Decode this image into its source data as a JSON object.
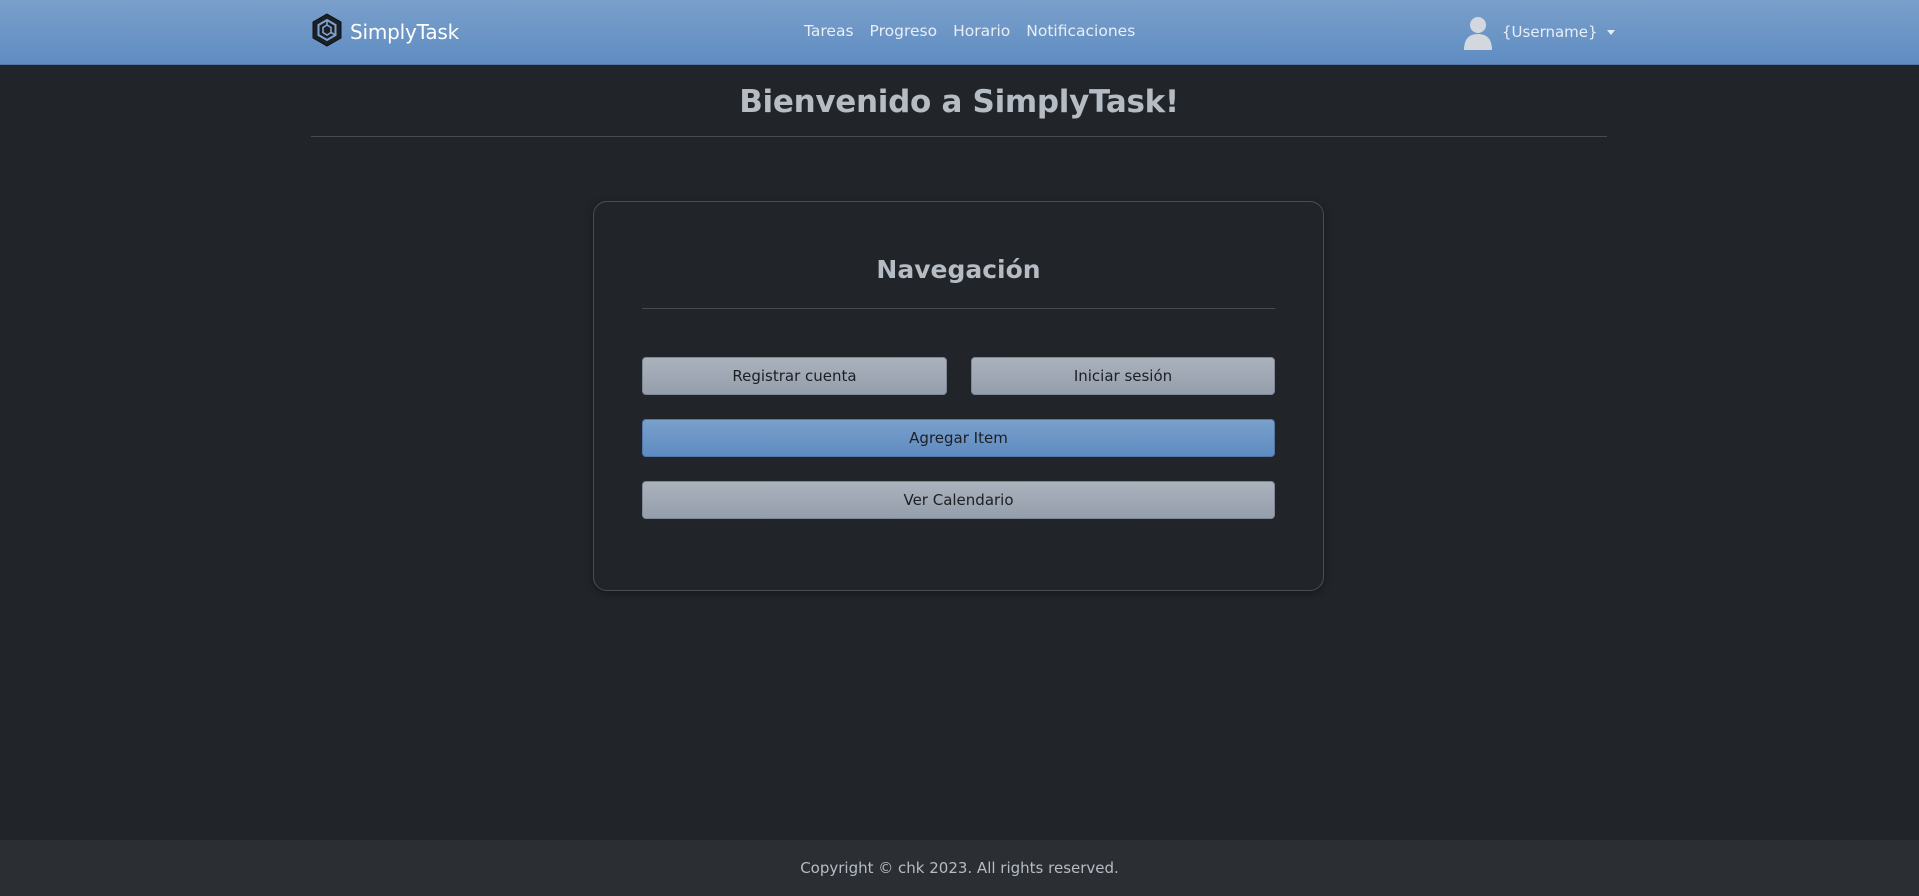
{
  "navbar": {
    "brand": "SimplyTask",
    "links": [
      "Tareas",
      "Progreso",
      "Horario",
      "Notificaciones"
    ],
    "username": "{Username}"
  },
  "main": {
    "title": "Bienvenido a SimplyTask!"
  },
  "card": {
    "title": "Navegación",
    "register_label": "Registrar cuenta",
    "login_label": "Iniciar sesión",
    "add_item_label": "Agregar Item",
    "calendar_label": "Ver Calendario"
  },
  "footer": {
    "copyright": "Copyright © chk 2023. All rights reserved."
  },
  "colors": {
    "navbar_accent": "#6b93c5",
    "background": "#212429",
    "footer_background": "#2b2f34",
    "secondary_button": "#a0a8b4",
    "primary_button": "#6b93c5"
  },
  "icons": {
    "brand": "hexagon-logo-icon",
    "user": "user-avatar-icon",
    "dropdown": "caret-down-icon"
  }
}
